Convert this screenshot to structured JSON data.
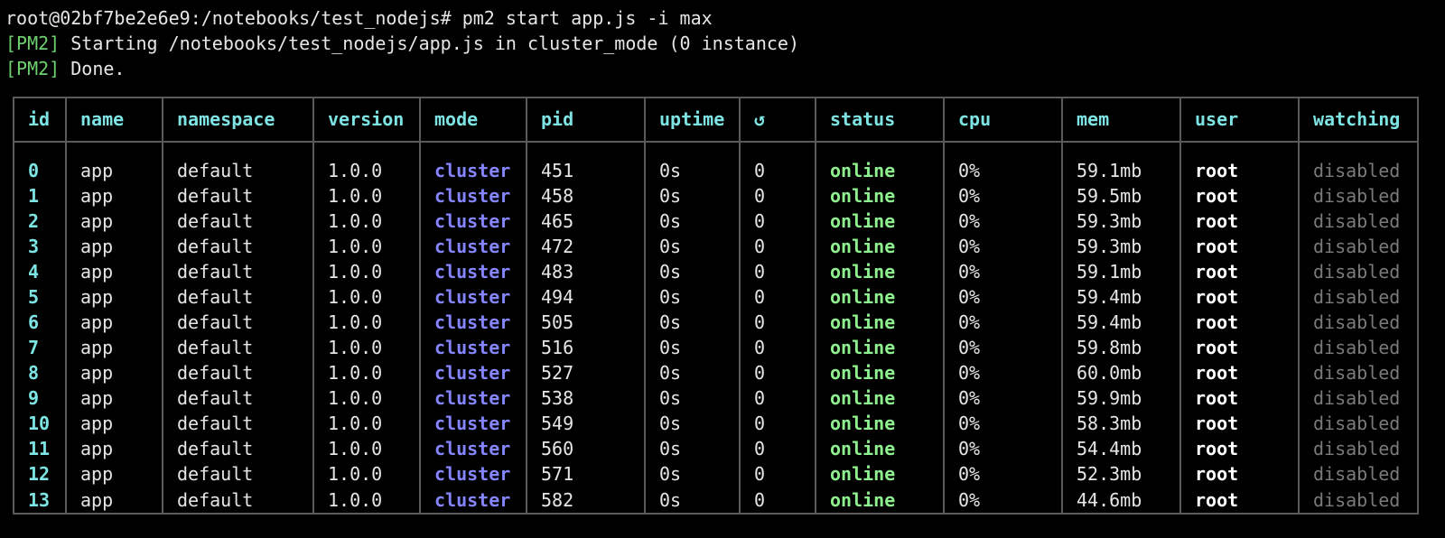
{
  "terminal": {
    "prompt_line": "root@02bf7be2e6e9:/notebooks/test_nodejs# pm2 start app.js -i max",
    "log_lines": [
      {
        "tag": "[PM2]",
        "text": " Starting /notebooks/test_nodejs/app.js in cluster_mode (0 instance)"
      },
      {
        "tag": "[PM2]",
        "text": " Done."
      }
    ]
  },
  "colors": {
    "background": "#000000",
    "text": "#e6e6e6",
    "pm2_tag": "#6fd16f",
    "header": "#7de3e3",
    "mode": "#8585ff",
    "status": "#8ef08e",
    "watching": "#7a7a7a",
    "border": "#5a5a5a"
  },
  "table": {
    "headers": [
      "id",
      "name",
      "namespace",
      "version",
      "mode",
      "pid",
      "uptime",
      "↺",
      "status",
      "cpu",
      "mem",
      "user",
      "watching"
    ],
    "rows": [
      [
        "0",
        "app",
        "default",
        "1.0.0",
        "cluster",
        "451",
        "0s",
        "0",
        "online",
        "0%",
        "59.1mb",
        "root",
        "disabled"
      ],
      [
        "1",
        "app",
        "default",
        "1.0.0",
        "cluster",
        "458",
        "0s",
        "0",
        "online",
        "0%",
        "59.5mb",
        "root",
        "disabled"
      ],
      [
        "2",
        "app",
        "default",
        "1.0.0",
        "cluster",
        "465",
        "0s",
        "0",
        "online",
        "0%",
        "59.3mb",
        "root",
        "disabled"
      ],
      [
        "3",
        "app",
        "default",
        "1.0.0",
        "cluster",
        "472",
        "0s",
        "0",
        "online",
        "0%",
        "59.3mb",
        "root",
        "disabled"
      ],
      [
        "4",
        "app",
        "default",
        "1.0.0",
        "cluster",
        "483",
        "0s",
        "0",
        "online",
        "0%",
        "59.1mb",
        "root",
        "disabled"
      ],
      [
        "5",
        "app",
        "default",
        "1.0.0",
        "cluster",
        "494",
        "0s",
        "0",
        "online",
        "0%",
        "59.4mb",
        "root",
        "disabled"
      ],
      [
        "6",
        "app",
        "default",
        "1.0.0",
        "cluster",
        "505",
        "0s",
        "0",
        "online",
        "0%",
        "59.4mb",
        "root",
        "disabled"
      ],
      [
        "7",
        "app",
        "default",
        "1.0.0",
        "cluster",
        "516",
        "0s",
        "0",
        "online",
        "0%",
        "59.8mb",
        "root",
        "disabled"
      ],
      [
        "8",
        "app",
        "default",
        "1.0.0",
        "cluster",
        "527",
        "0s",
        "0",
        "online",
        "0%",
        "60.0mb",
        "root",
        "disabled"
      ],
      [
        "9",
        "app",
        "default",
        "1.0.0",
        "cluster",
        "538",
        "0s",
        "0",
        "online",
        "0%",
        "59.9mb",
        "root",
        "disabled"
      ],
      [
        "10",
        "app",
        "default",
        "1.0.0",
        "cluster",
        "549",
        "0s",
        "0",
        "online",
        "0%",
        "58.3mb",
        "root",
        "disabled"
      ],
      [
        "11",
        "app",
        "default",
        "1.0.0",
        "cluster",
        "560",
        "0s",
        "0",
        "online",
        "0%",
        "54.4mb",
        "root",
        "disabled"
      ],
      [
        "12",
        "app",
        "default",
        "1.0.0",
        "cluster",
        "571",
        "0s",
        "0",
        "online",
        "0%",
        "52.3mb",
        "root",
        "disabled"
      ],
      [
        "13",
        "app",
        "default",
        "1.0.0",
        "cluster",
        "582",
        "0s",
        "0",
        "online",
        "0%",
        "44.6mb",
        "root",
        "disabled"
      ]
    ]
  }
}
